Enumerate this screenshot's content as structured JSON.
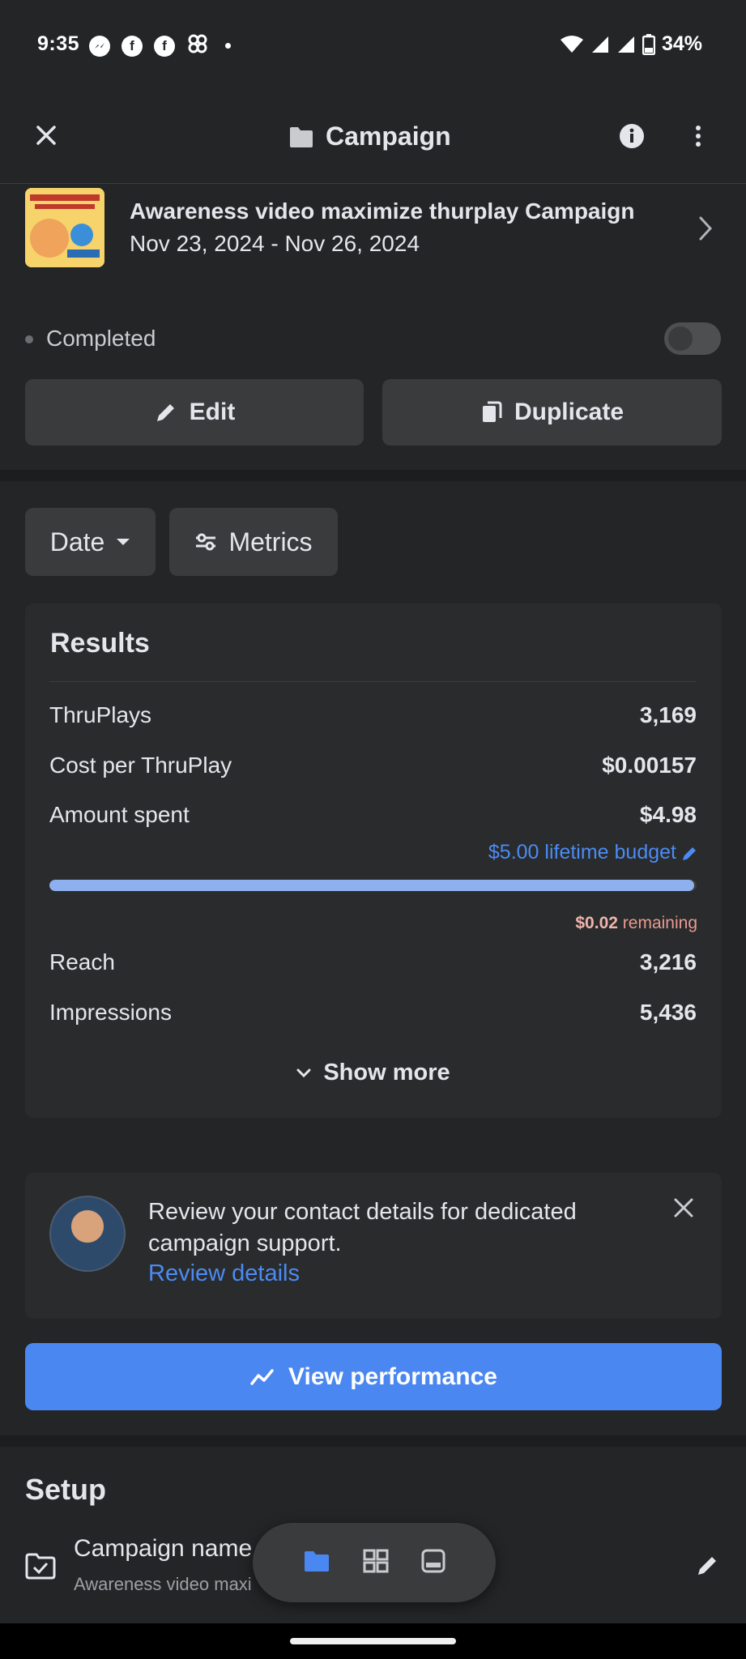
{
  "status_bar": {
    "time": "9:35",
    "battery": "34%",
    "icons": [
      "messenger-icon",
      "facebook-icon",
      "facebook-icon",
      "pinwheel-icon",
      "wifi-icon",
      "signal-icon",
      "signal-icon",
      "battery-icon"
    ]
  },
  "header": {
    "title": "Campaign",
    "icons": [
      "close-icon",
      "folder-icon",
      "info-icon",
      "more-vertical-icon"
    ]
  },
  "campaign": {
    "name": "Awareness video maximize thurplay Campaign",
    "date_range": "Nov 23, 2024 - Nov 26, 2024",
    "status": "Completed",
    "toggle_on": false
  },
  "actions": {
    "edit_label": "Edit",
    "duplicate_label": "Duplicate"
  },
  "filters": {
    "date_label": "Date",
    "metrics_label": "Metrics"
  },
  "results": {
    "title": "Results",
    "rows": [
      {
        "label": "ThruPlays",
        "value": "3,169"
      },
      {
        "label": "Cost per ThruPlay",
        "value": "$0.00157"
      },
      {
        "label": "Amount spent",
        "value": "$4.98"
      }
    ],
    "budget_link": "$5.00 lifetime budget",
    "spent_fraction": 0.996,
    "remaining_amount": "$0.02",
    "remaining_label": "remaining",
    "rows2": [
      {
        "label": "Reach",
        "value": "3,216"
      },
      {
        "label": "Impressions",
        "value": "5,436"
      }
    ],
    "show_more": "Show more"
  },
  "notice": {
    "text": "Review your contact details for dedicated campaign support.",
    "link": "Review details"
  },
  "view_performance": "View performance",
  "setup": {
    "title": "Setup",
    "field_label": "Campaign name",
    "field_value": "Awareness video maxi"
  },
  "colors": {
    "background": "#242526",
    "card": "#2a2b2c",
    "accent": "#4b87f0",
    "link": "#4b8bf5"
  }
}
